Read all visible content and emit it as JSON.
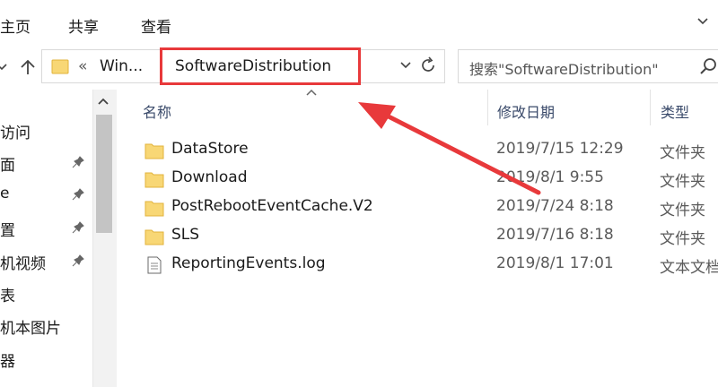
{
  "ribbon": {
    "tabs": [
      "主页",
      "共享",
      "查看"
    ]
  },
  "address": {
    "crumb_sep": "«",
    "crumb_parent": "Win...",
    "crumb_current": "SoftwareDistribution"
  },
  "search": {
    "placeholder": "搜索\"SoftwareDistribution\""
  },
  "nav": {
    "items": [
      "访问",
      "面",
      "e",
      "置",
      "机视频",
      "表",
      "机本图片",
      "器"
    ]
  },
  "columns": {
    "name": "名称",
    "modified": "修改日期",
    "type": "类型"
  },
  "files": [
    {
      "name": "DataStore",
      "modified": "2019/7/15 12:29",
      "type": "文件夹",
      "icon": "folder-icon"
    },
    {
      "name": "Download",
      "modified": "2019/8/1 9:55",
      "type": "文件夹",
      "icon": "folder-icon"
    },
    {
      "name": "PostRebootEventCache.V2",
      "modified": "2019/7/24 8:18",
      "type": "文件夹",
      "icon": "folder-icon"
    },
    {
      "name": "SLS",
      "modified": "2019/7/16 8:18",
      "type": "文件夹",
      "icon": "folder-icon"
    },
    {
      "name": "ReportingEvents.log",
      "modified": "2019/8/1 17:01",
      "type": "文本文档",
      "icon": "text-file-icon"
    }
  ],
  "colors": {
    "highlight": "#e8393b",
    "folder": "#f8d775",
    "folder_edge": "#e2b33c",
    "header_text": "#3a4a6a"
  }
}
